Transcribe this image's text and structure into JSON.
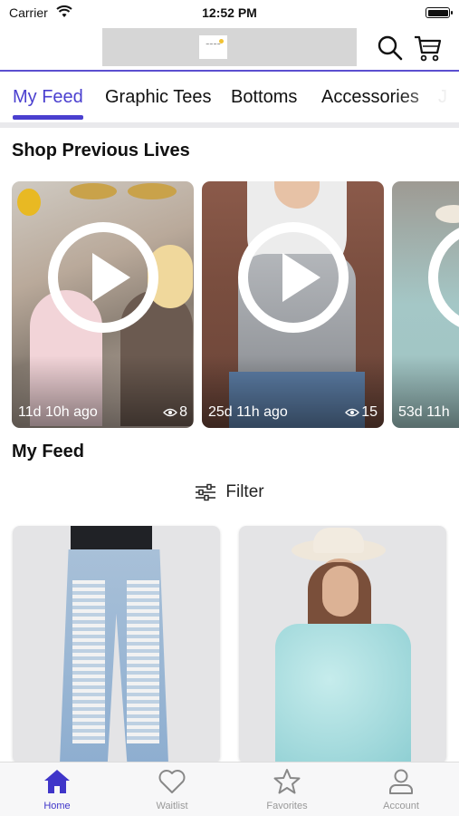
{
  "status_bar": {
    "carrier": "Carrier",
    "time": "12:52 PM"
  },
  "header": {
    "logo_text": "brand logo",
    "icons": [
      "search-icon",
      "cart-icon"
    ]
  },
  "tabs": [
    {
      "label": "My Feed",
      "active": true
    },
    {
      "label": "Graphic Tees",
      "active": false
    },
    {
      "label": "Bottoms",
      "active": false
    },
    {
      "label": "Accessories",
      "active": false
    },
    {
      "label": "J",
      "active": false
    }
  ],
  "previous_lives": {
    "title": "Shop Previous Lives",
    "cards": [
      {
        "time": "11d 10h ago",
        "views": "8"
      },
      {
        "time": "25d 11h ago",
        "views": "15"
      },
      {
        "time": "53d 11h",
        "views": ""
      }
    ]
  },
  "feed": {
    "title": "My Feed",
    "filter_label": "Filter"
  },
  "bottom_nav": [
    {
      "label": "Home",
      "icon": "home-icon",
      "active": true
    },
    {
      "label": "Waitlist",
      "icon": "heart-icon",
      "active": false
    },
    {
      "label": "Favorites",
      "icon": "star-icon",
      "active": false
    },
    {
      "label": "Account",
      "icon": "account-icon",
      "active": false
    }
  ],
  "colors": {
    "accent": "#4a3fcf",
    "inactive": "#999999"
  }
}
